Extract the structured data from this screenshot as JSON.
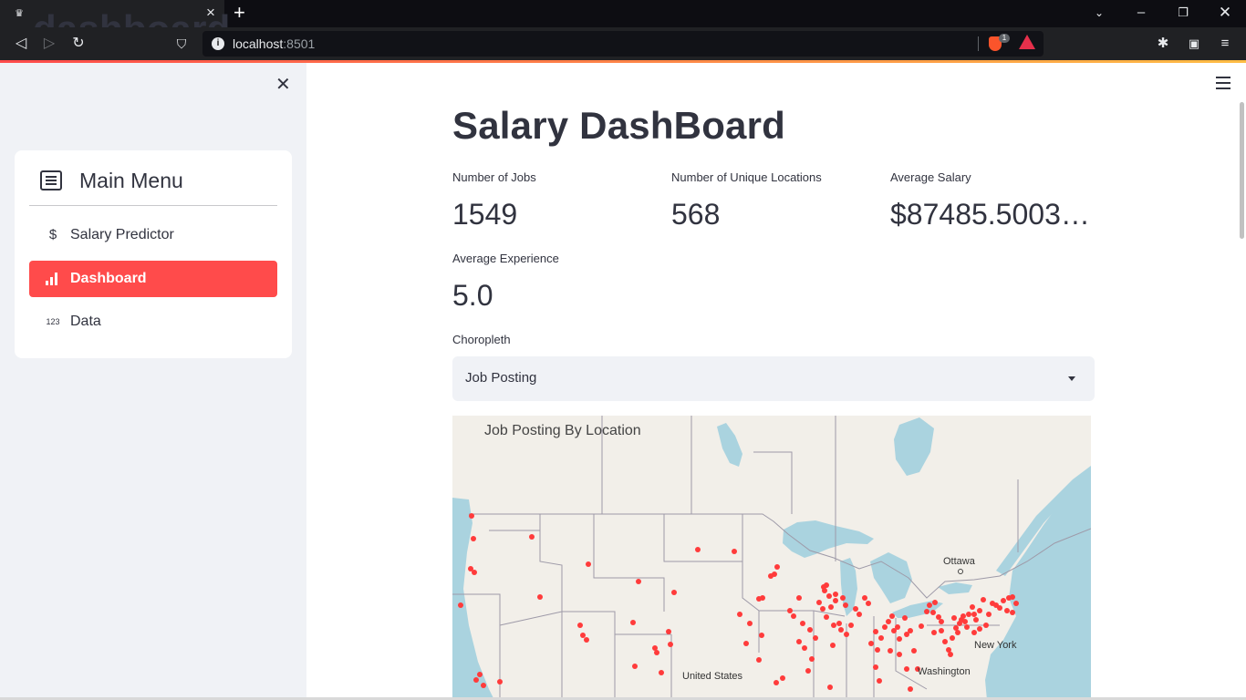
{
  "browser": {
    "tab_title": "dashboard · Streamlit",
    "url_host": "localhost",
    "url_port": ":8501",
    "brave_badge": "1"
  },
  "sidebar": {
    "menu_title": "Main Menu",
    "items": [
      {
        "icon": "$",
        "label": "Salary Predictor",
        "active": false
      },
      {
        "icon": "bar-chart-icon",
        "label": "Dashboard",
        "active": true
      },
      {
        "icon": "123",
        "label": "Data",
        "active": false
      }
    ]
  },
  "main": {
    "title": "Salary DashBoard",
    "metrics": [
      {
        "label": "Number of Jobs",
        "value": "1549"
      },
      {
        "label": "Number of Unique Locations",
        "value": "568"
      },
      {
        "label": "Average Salary",
        "value": "$87485.5003…"
      },
      {
        "label": "Average Experience",
        "value": "5.0"
      }
    ],
    "select": {
      "label": "Choropleth",
      "value": "Job Posting"
    },
    "map": {
      "title": "Job Posting By Location",
      "labels": [
        "Ottawa",
        "New York",
        "Washington",
        "United States"
      ]
    }
  },
  "colors": {
    "accent": "#ff4b4b",
    "text": "#31333f",
    "sidebar_bg": "#f0f2f6",
    "water": "#aad3df",
    "land": "#f2efe9",
    "dot": "#ff3333"
  }
}
